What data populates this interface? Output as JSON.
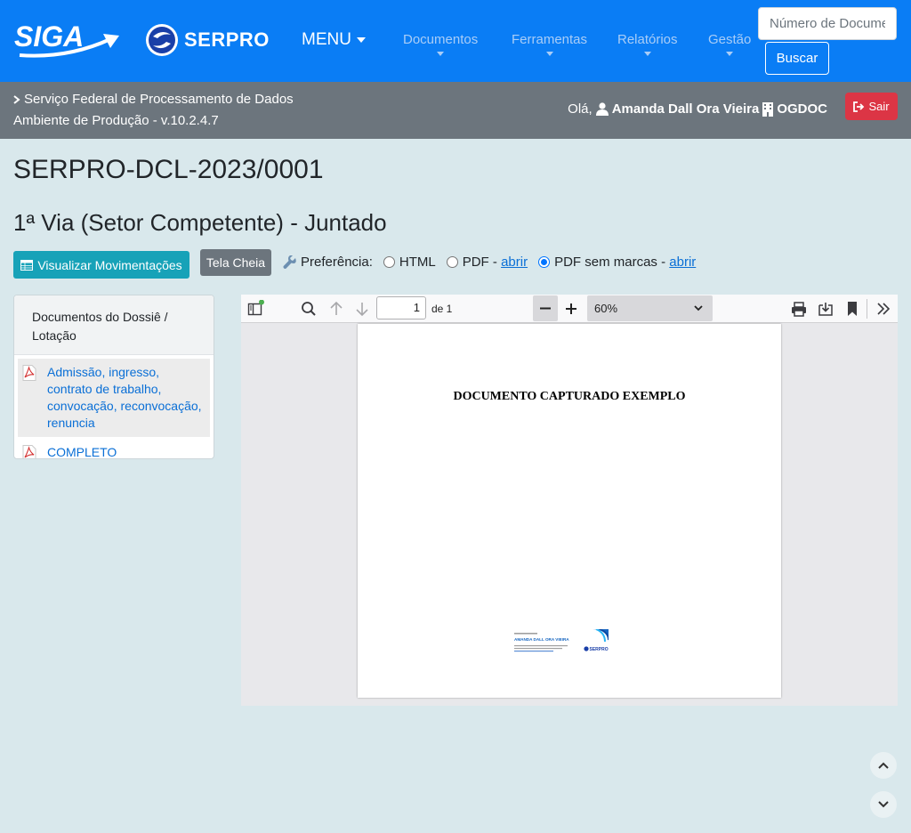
{
  "navbar": {
    "logo_text": "SIGA",
    "brand_text": "SERPRO",
    "menu_label": "MENU",
    "items": [
      {
        "label": "Documentos"
      },
      {
        "label": "Ferramentas"
      },
      {
        "label": "Relatórios"
      },
      {
        "label": "Gestão"
      }
    ],
    "search_placeholder": "Número de Documento",
    "search_button": "Buscar"
  },
  "infobar": {
    "org": "Serviço Federal de Processamento de Dados",
    "environment": "Ambiente de Produção - v.10.2.4.7",
    "greeting": "Olá,",
    "user_name": "Amanda Dall Ora Vieira",
    "unit": "OGDOC",
    "logout_label": "Sair"
  },
  "document": {
    "code": "SERPRO-DCL-2023/0001",
    "via_title": "1ª Via (Setor Competente) - Juntado"
  },
  "actions": {
    "movements_label": "Visualizar Movimentações",
    "fullscreen_label": "Tela Cheia",
    "preference_label": "Preferência:",
    "options": [
      {
        "label": "HTML",
        "link": "",
        "checked": false
      },
      {
        "label": "PDF -",
        "link": "abrir",
        "checked": false
      },
      {
        "label": "PDF sem marcas -",
        "link": "abrir",
        "checked": true
      }
    ]
  },
  "sidebar": {
    "header": "Documentos do Dossiê / Lotação",
    "items": [
      {
        "label": "Admissão, ingresso, contrato de trabalho, convocação, reconvocação, renuncia",
        "active": true
      },
      {
        "label": "COMPLETO",
        "active": false
      }
    ]
  },
  "viewer": {
    "page_number": "1",
    "page_of": "de 1",
    "zoom": "60%",
    "page_heading": "DOCUMENTO CAPTURADO EXEMPLO",
    "stamp_name": "AMANDA DALL ORA VIEIRA",
    "stamp_brand": "SERPRO"
  },
  "colors": {
    "navbar": "#0a7df5",
    "infobar": "#6c757d",
    "background": "#d9e8ec",
    "info_button": "#17a2b8",
    "danger_button": "#dc3545",
    "link": "#0a6fd6"
  }
}
